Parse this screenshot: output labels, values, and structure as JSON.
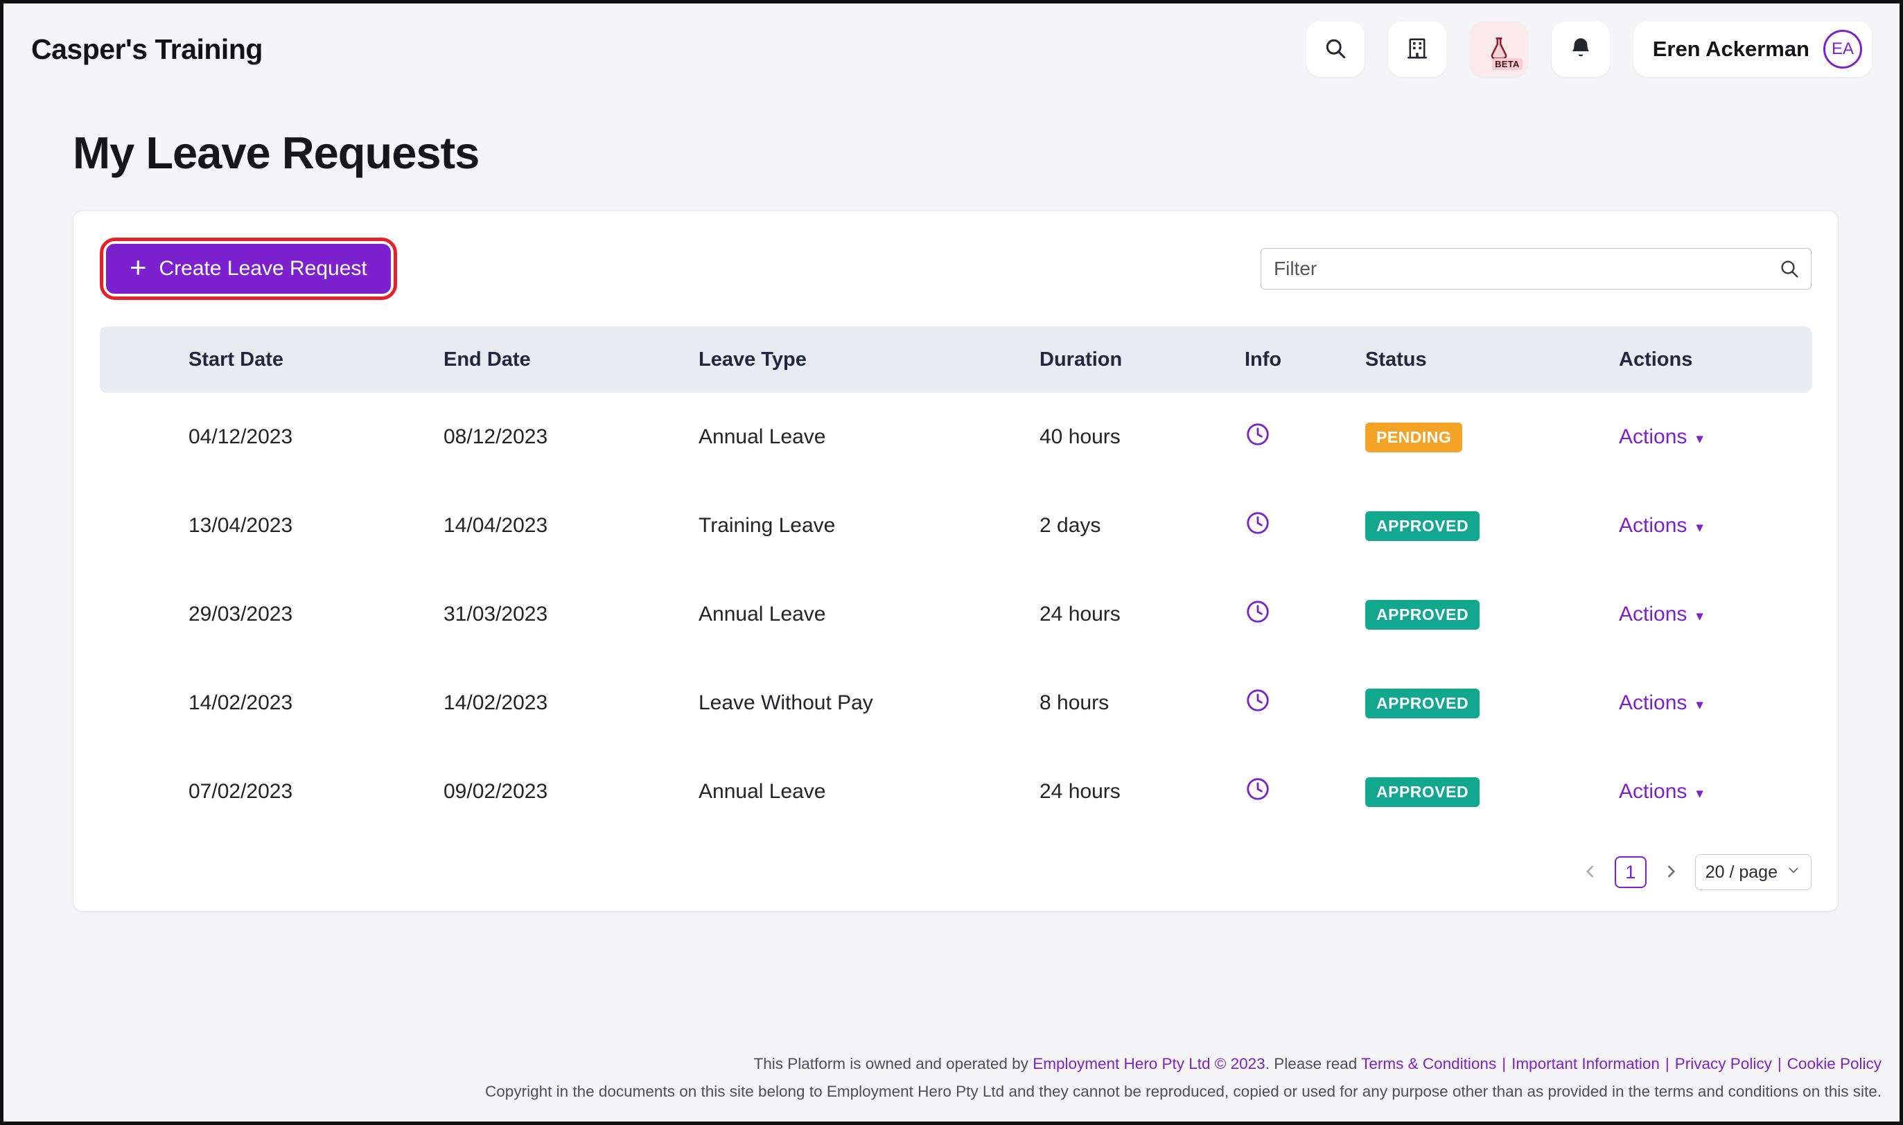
{
  "header": {
    "brand": "Casper's Training",
    "beta_label": "BETA",
    "user": {
      "name": "Eren Ackerman",
      "initials": "EA"
    }
  },
  "page": {
    "title": "My Leave Requests"
  },
  "toolbar": {
    "create_button": "Create Leave Request",
    "filter_placeholder": "Filter"
  },
  "icons": {
    "plus": "+",
    "caret_down": "▾"
  },
  "table": {
    "columns": [
      "Start Date",
      "End Date",
      "Leave Type",
      "Duration",
      "Info",
      "Status",
      "Actions"
    ],
    "actions_label": "Actions",
    "rows": [
      {
        "start_date": "04/12/2023",
        "end_date": "08/12/2023",
        "leave_type": "Annual Leave",
        "duration": "40 hours",
        "status": "PENDING",
        "status_color": "#F5A327"
      },
      {
        "start_date": "13/04/2023",
        "end_date": "14/04/2023",
        "leave_type": "Training Leave",
        "duration": "2 days",
        "status": "APPROVED",
        "status_color": "#12A88F"
      },
      {
        "start_date": "29/03/2023",
        "end_date": "31/03/2023",
        "leave_type": "Annual Leave",
        "duration": "24 hours",
        "status": "APPROVED",
        "status_color": "#12A88F"
      },
      {
        "start_date": "14/02/2023",
        "end_date": "14/02/2023",
        "leave_type": "Leave Without Pay",
        "duration": "8 hours",
        "status": "APPROVED",
        "status_color": "#12A88F"
      },
      {
        "start_date": "07/02/2023",
        "end_date": "09/02/2023",
        "leave_type": "Annual Leave",
        "duration": "24 hours",
        "status": "APPROVED",
        "status_color": "#12A88F"
      }
    ]
  },
  "pagination": {
    "current_page": "1",
    "page_size": "20 / page"
  },
  "colors": {
    "accent_purple": "#7B21CE",
    "highlight_red": "#E62129",
    "pending": "#F5A327",
    "approved": "#12A88F",
    "table_header_bg": "#E8EBF2"
  },
  "footer": {
    "line1_prefix": "This Platform is owned and operated by ",
    "line1_link": "Employment Hero Pty Ltd © 2023",
    "line1_middle": ". Please read ",
    "links": [
      "Terms & Conditions",
      "Important Information",
      "Privacy Policy",
      "Cookie Policy"
    ],
    "separator": "|",
    "line2": "Copyright in the documents on this site belong to Employment Hero Pty Ltd and they cannot be reproduced, copied or used for any purpose other than as provided in the terms and conditions on this site."
  }
}
